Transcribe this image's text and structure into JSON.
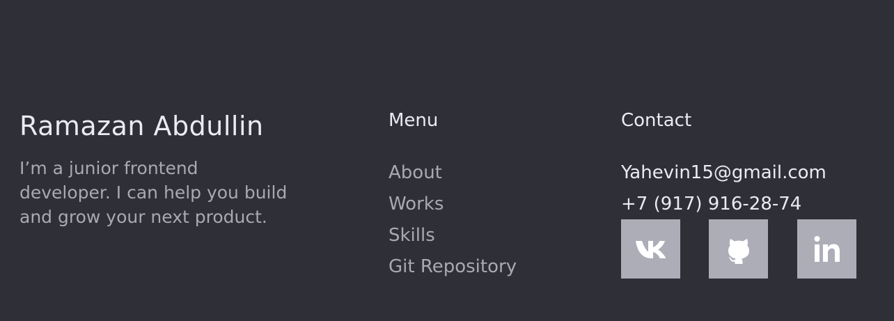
{
  "about": {
    "name": "Ramazan Abdullin",
    "bio": "I’m a junior frontend developer. I can help you build and grow your next product."
  },
  "menu": {
    "heading": "Menu",
    "items": [
      {
        "label": "About"
      },
      {
        "label": "Works"
      },
      {
        "label": "Skills"
      },
      {
        "label": "Git Repository"
      }
    ]
  },
  "contact": {
    "heading": "Contact",
    "email": "Yahevin15@gmail.com",
    "phone": "+7 (917) 916-28-74",
    "socials": [
      {
        "icon": "vk-icon"
      },
      {
        "icon": "github-icon"
      },
      {
        "icon": "linkedin-icon"
      }
    ]
  },
  "colors": {
    "background": "#2f2f38",
    "heading_text": "#ebebf0",
    "muted_text": "#a9a9b4",
    "social_tile": "#adadb8"
  }
}
